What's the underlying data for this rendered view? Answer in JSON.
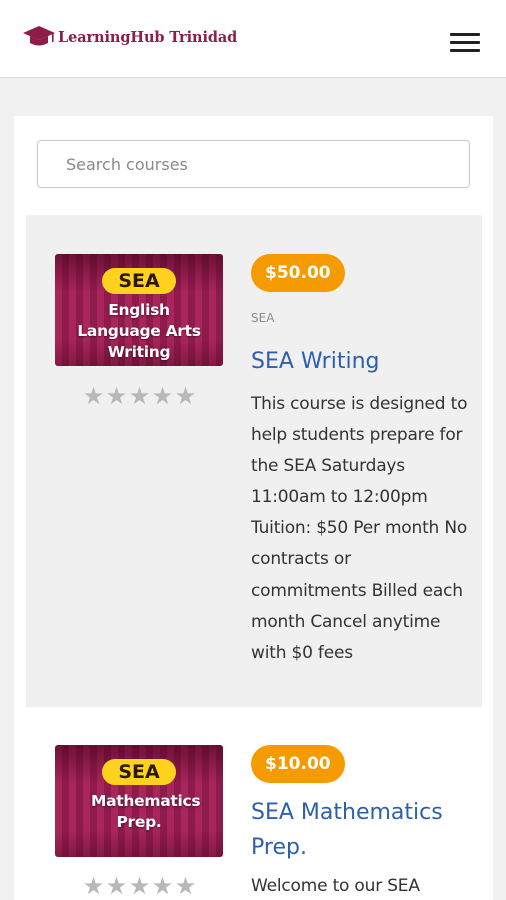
{
  "header": {
    "brand_name": "LearningHub Trinidad",
    "logo_icon": "graduation-cap-icon",
    "menu_icon": "hamburger-menu-icon",
    "brand_color": "#8e1d4a"
  },
  "search": {
    "placeholder": "Search courses",
    "value": ""
  },
  "courses": [
    {
      "thumbnail_badge": "SEA",
      "thumbnail_title": "English Language Arts Writing",
      "rating_stars": 0,
      "rating_max": 5,
      "price": "$50.00",
      "category": "SEA",
      "title": "SEA Writing",
      "description": "This course is designed to help students prepare for the SEA Saturdays 11:00am to 12:00pm Tuition: $50 Per month No contracts or commitments Billed each month Cancel anytime with $0 fees"
    },
    {
      "thumbnail_badge": "SEA",
      "thumbnail_title": "Mathematics Prep.",
      "rating_stars": 0,
      "rating_max": 5,
      "price": "$10.00",
      "category": "",
      "title": "SEA Mathematics Prep.",
      "description": "Welcome to our SEA"
    }
  ],
  "colors": {
    "price_badge": "#f59b00",
    "course_title": "#2e5fae",
    "thumbnail_badge": "#ffd21f"
  }
}
